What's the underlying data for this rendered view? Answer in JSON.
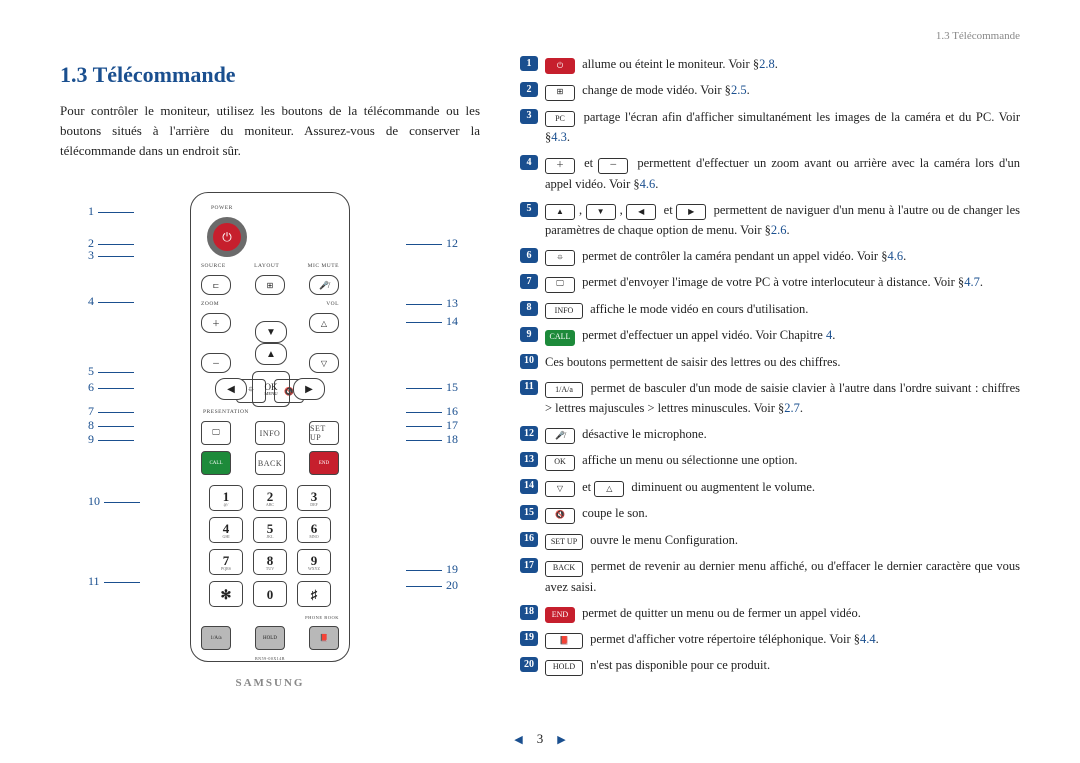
{
  "running_head": "1.3 Télécommande",
  "title": "1.3  Télécommande",
  "intro": "Pour contrôler le moniteur, utilisez les boutons de la télécommande ou les boutons situés à l'arrière du moniteur. Assurez-vous de conserver la télécommande dans un endroit sûr.",
  "remote": {
    "power_label": "POWER",
    "row2": [
      "SOURCE",
      "LAYOUT",
      "MIC MUTE"
    ],
    "row4_left": "ZOOM",
    "row4_right": "VOL",
    "ok": "OK",
    "ok_sub": "MENU",
    "cam_left": "⯐",
    "cam_right": "🔇",
    "presentation": "PRESENTATION",
    "row8": [
      "INFO",
      "SET UP"
    ],
    "row9": [
      "CALL",
      "BACK",
      "END"
    ],
    "grey_row": [
      "1/A/a",
      "HOLD",
      "PHONE BOOK"
    ],
    "brand": "SAMSUNG",
    "model": "BN59-00X14B",
    "num_sub": [
      "@/",
      "ABC",
      "DEF",
      "GHI",
      "JKL",
      "MNO",
      "PQRS",
      "TUV",
      "WXYZ"
    ]
  },
  "callouts_left": [
    "1",
    "2",
    "3",
    "4",
    "5",
    "6",
    "7",
    "8",
    "9",
    "10",
    "11"
  ],
  "callouts_right": [
    "12",
    "13",
    "14",
    "15",
    "16",
    "17",
    "18",
    "19",
    "20"
  ],
  "ref": {
    "s28": "2.8",
    "s25": "2.5",
    "s43": "4.3",
    "s46": "4.6",
    "s26": "2.6",
    "s47": "4.7",
    "ch4": "4",
    "s27": "2.7",
    "s44": "4.4"
  },
  "items": [
    {
      "n": "1",
      "icons": [
        {
          "cls": "red",
          "g": "⏻"
        }
      ],
      "text": "allume ou éteint le moniteur. Voir §",
      "ref": "s28",
      "suffix": "."
    },
    {
      "n": "2",
      "icons": [
        {
          "g": "⊞"
        }
      ],
      "text": "change de mode vidéo. Voir §",
      "ref": "s25",
      "suffix": "."
    },
    {
      "n": "3",
      "icons": [
        {
          "g": "PC"
        }
      ],
      "text": "partage l'écran afin d'afficher simultanément les images de la caméra et du PC. Voir §",
      "ref": "s43",
      "suffix": "."
    },
    {
      "n": "4",
      "icons": [
        {
          "g": "＋"
        },
        {
          "plain": " et "
        },
        {
          "g": "－"
        }
      ],
      "text": "permettent d'effectuer un zoom avant ou arrière avec la caméra lors d'un appel vidéo. Voir §",
      "ref": "s46",
      "suffix": "."
    },
    {
      "n": "5",
      "icons": [
        {
          "g": "▲"
        },
        {
          "plain": ", "
        },
        {
          "g": "▼"
        },
        {
          "plain": ", "
        },
        {
          "g": "◀"
        },
        {
          "plain": " et "
        },
        {
          "g": "▶"
        }
      ],
      "text": "permettent de naviguer d'un menu à l'autre ou de changer les paramètres de chaque option de menu. Voir §",
      "ref": "s26",
      "suffix": "."
    },
    {
      "n": "6",
      "icons": [
        {
          "g": "⯐"
        }
      ],
      "text": "permet de contrôler la caméra pendant un appel vidéo. Voir §",
      "ref": "s46",
      "suffix": "."
    },
    {
      "n": "7",
      "icons": [
        {
          "g": "🖵"
        }
      ],
      "text": "permet d'envoyer l'image de votre PC à votre interlocuteur à distance. Voir §",
      "ref": "s47",
      "suffix": "."
    },
    {
      "n": "8",
      "icons": [
        {
          "cls": "wide",
          "g": "INFO"
        }
      ],
      "text": "affiche le mode vidéo en cours d'utilisation."
    },
    {
      "n": "9",
      "icons": [
        {
          "cls": "green",
          "g": "CALL"
        }
      ],
      "text": "permet d'effectuer un appel vidéo. Voir Chapitre ",
      "ref": "ch4",
      "suffix": "."
    },
    {
      "n": "10",
      "text": "Ces boutons permettent de saisir des lettres ou des chiffres."
    },
    {
      "n": "11",
      "icons": [
        {
          "cls": "wide",
          "g": "1/A/a"
        }
      ],
      "text": "permet de basculer d'un mode de saisie clavier à l'autre dans l'ordre suivant : chiffres > lettres majuscules > lettres minuscules. Voir §",
      "ref": "s27",
      "suffix": "."
    },
    {
      "n": "12",
      "icons": [
        {
          "g": "🎤̸"
        }
      ],
      "text": "désactive le microphone."
    },
    {
      "n": "13",
      "icons": [
        {
          "g": "OK"
        }
      ],
      "text": "affiche un menu ou sélectionne une option."
    },
    {
      "n": "14",
      "icons": [
        {
          "g": "▽"
        },
        {
          "plain": " et "
        },
        {
          "g": "△"
        }
      ],
      "text": "diminuent ou augmentent le volume."
    },
    {
      "n": "15",
      "icons": [
        {
          "g": "🔇"
        }
      ],
      "text": "coupe le son."
    },
    {
      "n": "16",
      "icons": [
        {
          "cls": "wide",
          "g": "SET UP"
        }
      ],
      "text": "ouvre le menu Configuration."
    },
    {
      "n": "17",
      "icons": [
        {
          "cls": "wide",
          "g": "BACK"
        }
      ],
      "text": "permet de revenir au dernier menu affiché, ou d'effacer le dernier caractère que vous avez saisi."
    },
    {
      "n": "18",
      "icons": [
        {
          "cls": "red",
          "g": "END"
        }
      ],
      "text": "permet de quitter un menu ou de fermer un appel vidéo."
    },
    {
      "n": "19",
      "icons": [
        {
          "cls": "wide",
          "g": "📕"
        }
      ],
      "text": "permet d'afficher votre répertoire téléphonique. Voir §",
      "ref": "s44",
      "suffix": "."
    },
    {
      "n": "20",
      "icons": [
        {
          "cls": "wide",
          "g": "HOLD"
        }
      ],
      "text": "n'est pas disponible pour ce produit."
    }
  ],
  "page_number": "3"
}
